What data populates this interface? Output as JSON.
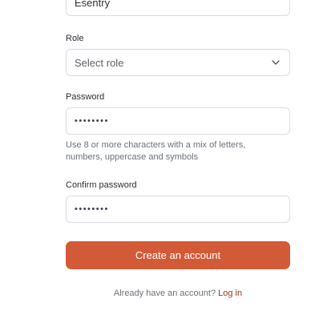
{
  "fields": {
    "username_value": "Esentry",
    "role_label": "Role",
    "role_placeholder": "Select role",
    "password_label": "Password",
    "password_value": "••••••••",
    "password_hint": "Use 8 or more characters with a mix of letters, numbers, uppercase and symbols",
    "confirm_label": "Confirm password",
    "confirm_value": "••••••••"
  },
  "actions": {
    "submit_label": "Create an account",
    "footer_text": "Already have an account?",
    "login_link": "Log in"
  },
  "colors": {
    "primary": "#d35a37",
    "link": "#9a3412"
  }
}
